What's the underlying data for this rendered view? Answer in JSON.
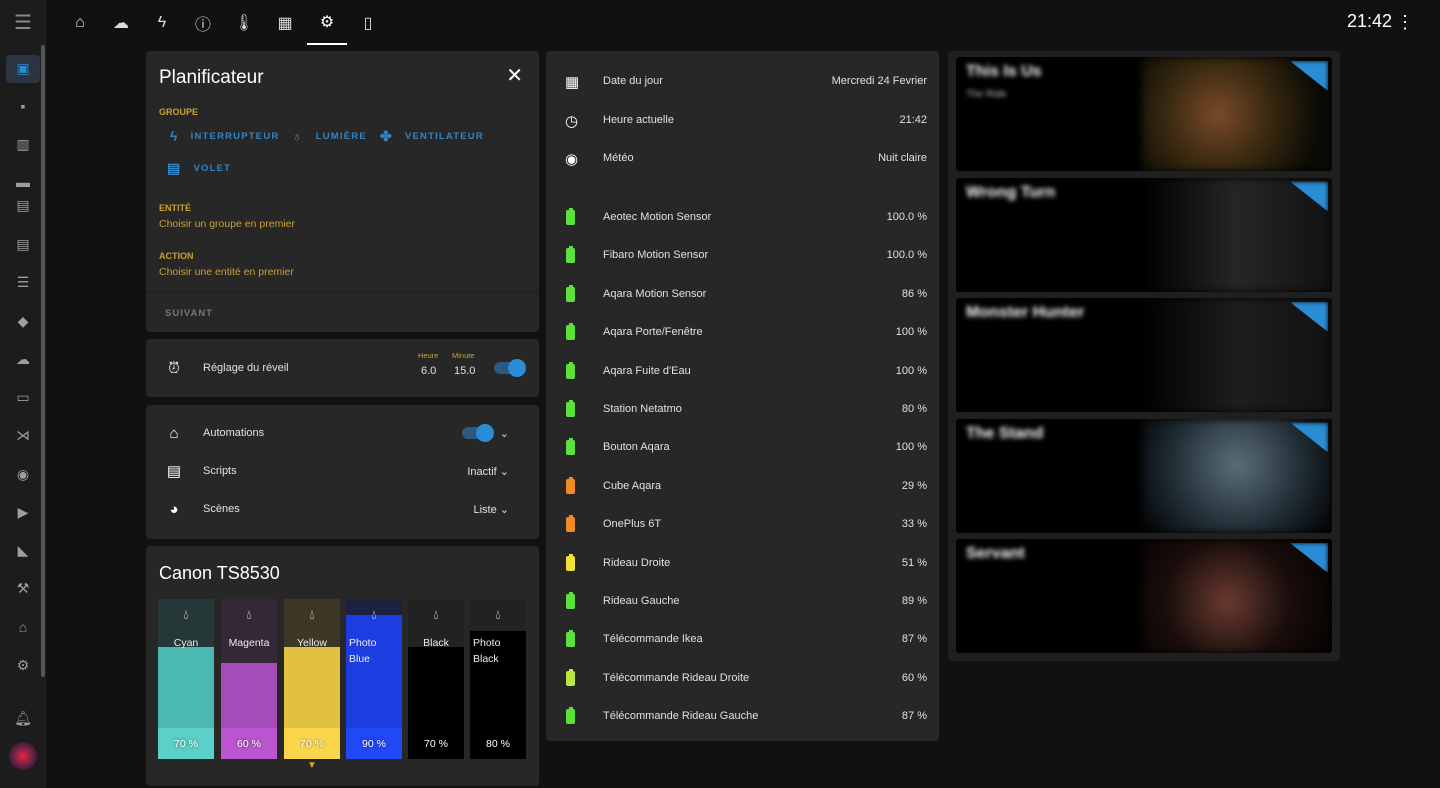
{
  "topbar": {
    "clock": "21:42",
    "tabs": [
      "home-automation-icon",
      "weather-night-icon",
      "flash-icon",
      "info-icon",
      "thermometer-icon",
      "floor-plan-icon",
      "settings-icon",
      "test-tube-icon"
    ],
    "active_tab": 6
  },
  "sidebar": {
    "items": [
      "dashboard",
      "person",
      "chart",
      "lan",
      "chip",
      "hacs",
      "notes",
      "docker",
      "cloud",
      "terminal",
      "vscode",
      "compass",
      "media",
      "cctv",
      "hammer",
      "home-settings",
      "settings"
    ],
    "active": 0
  },
  "planner": {
    "title": "Planificateur",
    "groupe_label": "GROUPE",
    "groups": [
      {
        "icon": "flash",
        "label": "INTERRUPTEUR"
      },
      {
        "icon": "lightbulb",
        "label": "LUMIÈRE"
      },
      {
        "icon": "fan",
        "label": "VENTILATEUR"
      },
      {
        "icon": "blinds",
        "label": "VOLET"
      }
    ],
    "entite_label": "ENTITÉ",
    "entite_value": "Choisir un groupe en premier",
    "action_label": "ACTION",
    "action_value": "Choisir une entité en premier",
    "next": "SUIVANT"
  },
  "alarm": {
    "label": "Réglage du réveil",
    "hour_label": "Heure",
    "hour": "6.0",
    "minute_label": "Minute",
    "minute": "15.0",
    "enabled": true
  },
  "controls": {
    "automations": "Automations",
    "automations_on": true,
    "scripts": "Scripts",
    "scripts_value": "Inactif",
    "scenes": "Scènes",
    "scenes_value": "Liste"
  },
  "printer": {
    "title": "Canon TS8530",
    "inks": [
      {
        "name": "Cyan",
        "level": 70,
        "label": "70 %",
        "color": "#4cb8b2",
        "bg": "#263737",
        "bottom": "#5ad0c8"
      },
      {
        "name": "Magenta",
        "level": 60,
        "label": "60 %",
        "color": "#a64cb8",
        "bg": "#342838",
        "bottom": "#bb55d0"
      },
      {
        "name": "Yellow",
        "level": 70,
        "label": "70 %",
        "color": "#e2c040",
        "bg": "#3d3823",
        "bottom": "#fcd64a"
      },
      {
        "name": "Photo Blue",
        "level": 90,
        "label": "90 %",
        "color": "#1c3de0",
        "bg": "#1e2040",
        "bottom": "#2247f5"
      },
      {
        "name": "Black",
        "level": 70,
        "label": "70 %",
        "color": "#000000",
        "bg": "#222222",
        "bottom": "#000000"
      },
      {
        "name": "Photo Black",
        "level": 80,
        "label": "80 %",
        "color": "#000000",
        "bg": "#222222",
        "bottom": "#000000"
      }
    ]
  },
  "info": [
    {
      "icon": "calendar",
      "label": "Date du jour",
      "value": "Mercredi 24 Fevrier"
    },
    {
      "icon": "clock",
      "label": "Heure actuelle",
      "value": "21:42"
    },
    {
      "icon": "eye",
      "label": "Météo",
      "value": "Nuit claire"
    }
  ],
  "batteries": [
    {
      "name": "Aeotec Motion Sensor",
      "value": "100.0 %",
      "color": "#5ee03a"
    },
    {
      "name": "Fibaro Motion Sensor",
      "value": "100.0 %",
      "color": "#5ee03a"
    },
    {
      "name": "Aqara Motion Sensor",
      "value": "86 %",
      "color": "#5ee03a"
    },
    {
      "name": "Aqara Porte/Fenêtre",
      "value": "100 %",
      "color": "#5ee03a"
    },
    {
      "name": "Aqara Fuite d'Eau",
      "value": "100 %",
      "color": "#5ee03a"
    },
    {
      "name": "Station Netatmo",
      "value": "80 %",
      "color": "#5ee03a"
    },
    {
      "name": "Bouton Aqara",
      "value": "100 %",
      "color": "#5ee03a"
    },
    {
      "name": "Cube Aqara",
      "value": "29 %",
      "color": "#f08a24"
    },
    {
      "name": "OnePlus 6T",
      "value": "33 %",
      "color": "#f08a24"
    },
    {
      "name": "Rideau Droite",
      "value": "51 %",
      "color": "#f0e03a"
    },
    {
      "name": "Rideau Gauche",
      "value": "89 %",
      "color": "#5ee03a"
    },
    {
      "name": "Télécommande Ikea",
      "value": "87 %",
      "color": "#5ee03a"
    },
    {
      "name": "Télécommande Rideau Droite",
      "value": "60 %",
      "color": "#b8e83a"
    },
    {
      "name": "Télécommande Rideau Gauche",
      "value": "87 %",
      "color": "#5ee03a"
    }
  ],
  "media": [
    {
      "title": "This Is Us",
      "sub": "The Ride"
    },
    {
      "title": "Wrong Turn",
      "sub": ""
    },
    {
      "title": "Monster Hunter",
      "sub": ""
    },
    {
      "title": "The Stand",
      "sub": ""
    },
    {
      "title": "Servant",
      "sub": ""
    }
  ]
}
